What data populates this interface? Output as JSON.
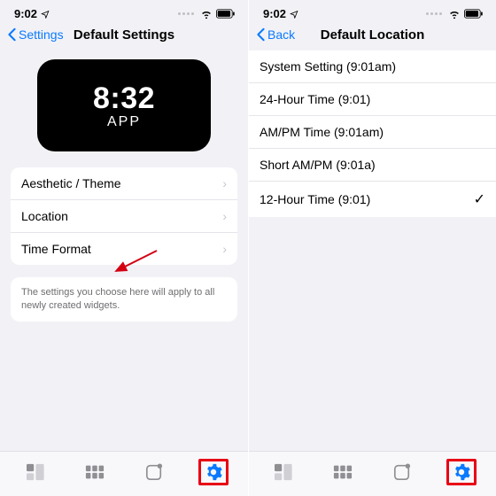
{
  "status": {
    "time": "9:02"
  },
  "left": {
    "nav": {
      "back": "Settings",
      "title": "Default Settings"
    },
    "preview": {
      "time": "8:32",
      "label": "APP"
    },
    "menu": [
      {
        "label": "Aesthetic / Theme"
      },
      {
        "label": "Location"
      },
      {
        "label": "Time Format"
      }
    ],
    "note": "The settings you choose here will apply to all newly created widgets."
  },
  "right": {
    "nav": {
      "back": "Back",
      "title": "Default Location"
    },
    "options": [
      {
        "label": "System Setting (9:01am)",
        "checked": false
      },
      {
        "label": "24-Hour Time (9:01)",
        "checked": false
      },
      {
        "label": "AM/PM Time (9:01am)",
        "checked": false
      },
      {
        "label": "Short AM/PM (9:01a)",
        "checked": false
      },
      {
        "label": "12-Hour Time (9:01)",
        "checked": true
      }
    ]
  },
  "colors": {
    "accent": "#0a7aff",
    "highlight": "#e80014"
  }
}
